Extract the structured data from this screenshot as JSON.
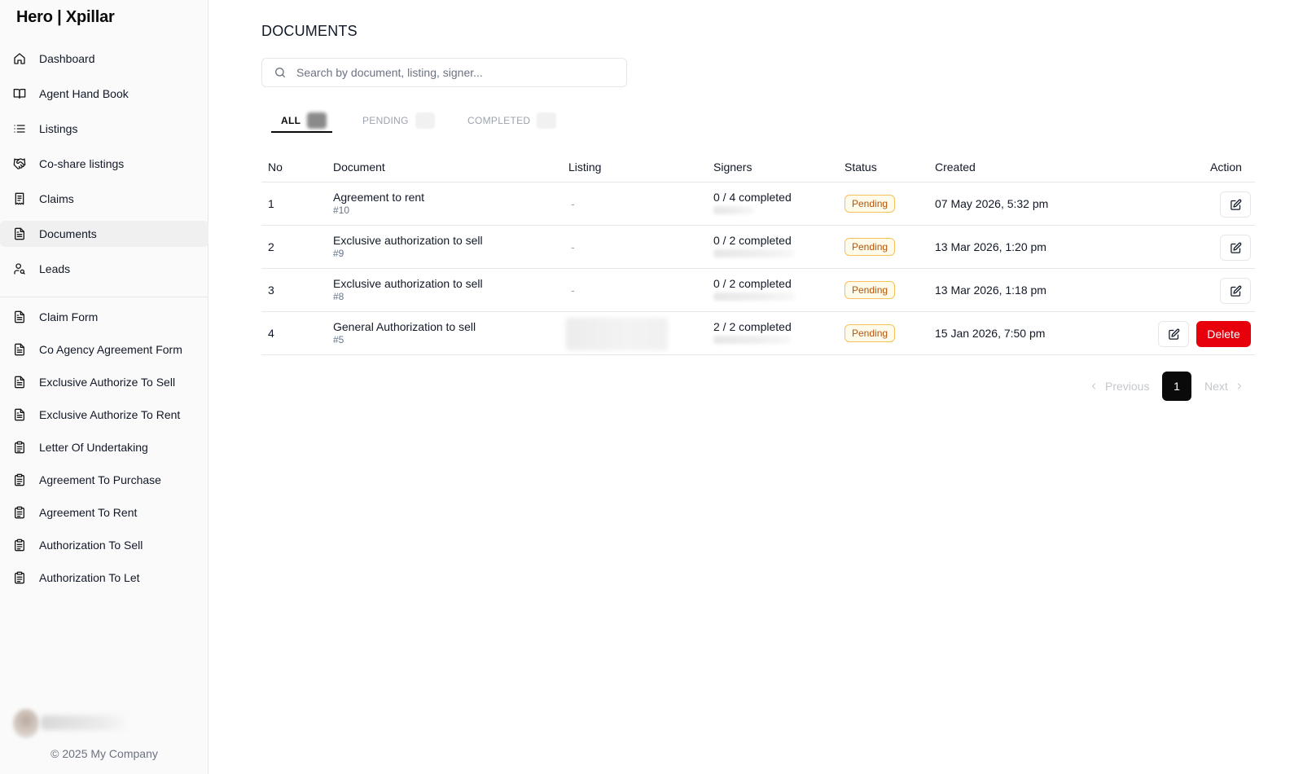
{
  "app": {
    "brand": "Hero | Xpillar"
  },
  "sidebar": {
    "primary": [
      {
        "label": "Dashboard",
        "icon": "home-icon"
      },
      {
        "label": "Agent Hand Book",
        "icon": "book-open-icon"
      },
      {
        "label": "Listings",
        "icon": "list-icon"
      },
      {
        "label": "Co-share listings",
        "icon": "handshake-icon"
      },
      {
        "label": "Claims",
        "icon": "receipt-icon"
      },
      {
        "label": "Documents",
        "icon": "file-text-icon",
        "active": true
      },
      {
        "label": "Leads",
        "icon": "user-search-icon"
      }
    ],
    "forms": [
      {
        "label": "Claim Form",
        "icon": "file-text-icon"
      },
      {
        "label": "Co Agency Agreement Form",
        "icon": "file-text-icon"
      },
      {
        "label": "Exclusive Authorize To Sell",
        "icon": "file-text-icon"
      },
      {
        "label": "Exclusive Authorize To Rent",
        "icon": "file-text-icon"
      },
      {
        "label": "Letter Of Undertaking",
        "icon": "clipboard-icon"
      },
      {
        "label": "Agreement To Purchase",
        "icon": "clipboard-icon"
      },
      {
        "label": "Agreement To Rent",
        "icon": "clipboard-icon"
      },
      {
        "label": "Authorization To Sell",
        "icon": "clipboard-icon"
      },
      {
        "label": "Authorization To Let",
        "icon": "clipboard-icon"
      }
    ],
    "footer": "© 2025 My Company"
  },
  "main": {
    "title": "DOCUMENTS",
    "search": {
      "placeholder": "Search by document, listing, signer...",
      "value": ""
    },
    "tabs": [
      {
        "label": "ALL",
        "active": true
      },
      {
        "label": "PENDING",
        "active": false
      },
      {
        "label": "COMPLETED",
        "active": false
      }
    ],
    "table": {
      "columns": [
        "No",
        "Document",
        "Listing",
        "Signers",
        "Status",
        "Created",
        "Action"
      ],
      "rows": [
        {
          "no": "1",
          "document": "Agreement to rent",
          "doc_id": "#10",
          "listing": "-",
          "signers": "0 / 4 completed",
          "status": "Pending",
          "created": "07 May 2026, 5:32 pm"
        },
        {
          "no": "2",
          "document": "Exclusive authorization to sell",
          "doc_id": "#9",
          "listing": "-",
          "signers": "0 / 2 completed",
          "status": "Pending",
          "created": "13 Mar 2026, 1:20 pm"
        },
        {
          "no": "3",
          "document": "Exclusive authorization to sell",
          "doc_id": "#8",
          "listing": "-",
          "signers": "0 / 2 completed",
          "status": "Pending",
          "created": "13 Mar 2026, 1:18 pm"
        },
        {
          "no": "4",
          "document": "General Authorization to sell",
          "doc_id": "#5",
          "listing": "",
          "signers": "2 / 2 completed",
          "status": "Pending",
          "created": "15 Jan 2026, 7:50 pm",
          "delete_label": "Delete"
        }
      ]
    },
    "pagination": {
      "previous": "Previous",
      "current": "1",
      "next": "Next"
    }
  },
  "colors": {
    "accent": "#0a0a0a",
    "danger": "#e7000b",
    "pending_text": "#b45309",
    "pending_border": "#f4c15a"
  }
}
